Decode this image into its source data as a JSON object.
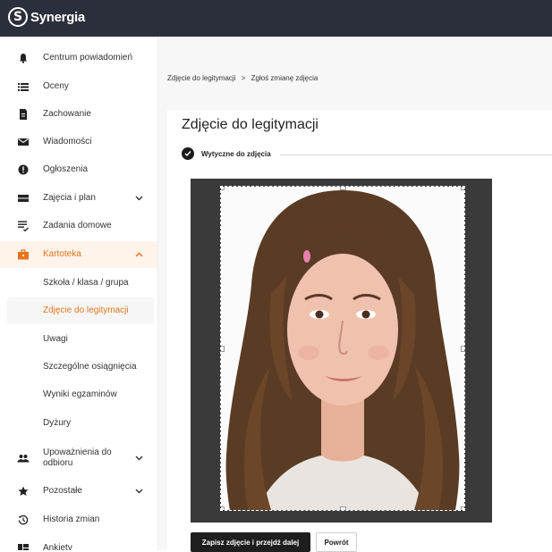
{
  "app": {
    "logo_letter": "S",
    "logo_text": "Synergia"
  },
  "sidebar": {
    "items": [
      {
        "label": "Centrum powiadomień",
        "icon": "bell-icon"
      },
      {
        "label": "Oceny",
        "icon": "list-icon"
      },
      {
        "label": "Zachowanie",
        "icon": "document-icon"
      },
      {
        "label": "Wiadomości",
        "icon": "envelope-icon"
      },
      {
        "label": "Ogłoszenia",
        "icon": "megaphone-icon"
      },
      {
        "label": "Zajęcia i plan",
        "icon": "calendar-icon",
        "expanded": false
      },
      {
        "label": "Zadania domowe",
        "icon": "homework-icon"
      },
      {
        "label": "Kartoteka",
        "icon": "briefcase-icon",
        "expanded": true
      },
      {
        "label": "Szkoła / klasa / grupa"
      },
      {
        "label": "Zdjęcie do legitymacji",
        "active": true
      },
      {
        "label": "Uwagi"
      },
      {
        "label": "Szczególne osiągnięcia"
      },
      {
        "label": "Wyniki egzaminów"
      },
      {
        "label": "Dyżury"
      },
      {
        "label": "Upoważnienia do odbioru",
        "icon": "people-icon",
        "expanded": false
      },
      {
        "label": "Pozostałe",
        "icon": "star-icon",
        "expanded": false
      },
      {
        "label": "Historia zmian",
        "icon": "history-icon"
      },
      {
        "label": "Ankiety",
        "icon": "poll-icon"
      }
    ]
  },
  "breadcrumb": {
    "parent": "Zdjęcie do legitymacji",
    "separator": ">",
    "current": "Zgłoś zmianę zdjęcia"
  },
  "page": {
    "title": "Zdjęcie do legitymacji"
  },
  "stepper": {
    "step1_label": "Wytyczne do zdjęcia"
  },
  "actions": {
    "save_label": "Zapisz zdjęcie i przejdź dalej",
    "back_label": "Powrót"
  },
  "colors": {
    "accent": "#e8741c",
    "topbar": "#2b2f3b",
    "primary_button": "#1e1e1e"
  }
}
